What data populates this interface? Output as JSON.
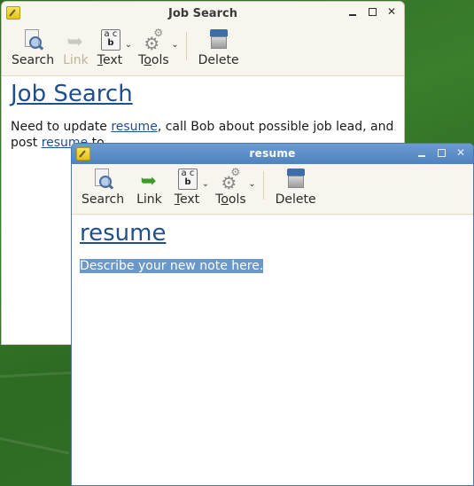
{
  "windows": [
    {
      "title": "Job Search",
      "app_icon": "note-pencil-icon",
      "wm_buttons": [
        "minimize",
        "maximize",
        "close"
      ],
      "wm_labels": {
        "close": "✕"
      },
      "toolbar": {
        "search": "Search",
        "link": "Link",
        "link_enabled": false,
        "text": "ext",
        "text_mnemonic": "T",
        "tools_pre": "T",
        "tools_mnemonic": "o",
        "tools_post": "ols",
        "delete": "Delete",
        "dropdown": "⌄"
      },
      "note": {
        "title": "Job Search",
        "body_parts": [
          {
            "text": "Need to update ",
            "link": false
          },
          {
            "text": "resume",
            "link": true
          },
          {
            "text": ", call Bob about possible job lead, and post ",
            "link": false
          },
          {
            "text": "resume",
            "link": true
          },
          {
            "text": " to",
            "link": false
          }
        ]
      }
    },
    {
      "title": "resume",
      "app_icon": "note-pencil-icon",
      "wm_buttons": [
        "minimize",
        "maximize",
        "close"
      ],
      "wm_labels": {
        "close": "✕"
      },
      "toolbar": {
        "search": "Search",
        "link": "Link",
        "link_enabled": true,
        "text": "ext",
        "text_mnemonic": "T",
        "tools_pre": "T",
        "tools_mnemonic": "o",
        "tools_post": "ols",
        "delete": "Delete",
        "dropdown": "⌄"
      },
      "note": {
        "title": "resume",
        "body_selected": "Describe your new note here."
      }
    }
  ],
  "icons": {
    "link_arrow": "➥",
    "gear_large": "⚙",
    "gear_small": "⚙",
    "text_icon_top": "a c",
    "text_icon_bottom": "b"
  },
  "colors": {
    "link": "#1f4f8c",
    "link_icon_enabled": "#3a9a2a",
    "link_icon_disabled": "#c9c9c0",
    "selection": "#6a98c9",
    "active_titlebar": "#5a8cc6"
  }
}
